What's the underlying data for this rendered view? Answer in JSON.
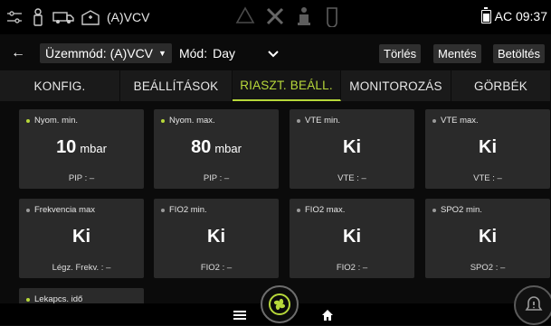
{
  "status": {
    "mode_text": "(A)VCV",
    "time_text": "AC 09:37"
  },
  "toolbar": {
    "mode_select": "Üzemmód: (A)VCV",
    "mod_label": "Mód:",
    "mod_value": "Day",
    "delete_label": "Törlés",
    "save_label": "Mentés",
    "load_label": "Betöltés"
  },
  "tabs": [
    {
      "label": "KONFIG."
    },
    {
      "label": "BEÁLLÍTÁSOK"
    },
    {
      "label": "RIASZT. BEÁLL."
    },
    {
      "label": "MONITOROZÁS"
    },
    {
      "label": "GÖRBÉK"
    }
  ],
  "active_tab_index": 2,
  "alarms": [
    {
      "title": "Nyom. min.",
      "value": "10",
      "unit": "mbar",
      "sub": "PIP : –"
    },
    {
      "title": "Nyom. max.",
      "value": "80",
      "unit": "mbar",
      "sub": "PIP : –"
    },
    {
      "title": "VTE min.",
      "value": "Ki",
      "unit": "",
      "sub": "VTE : –"
    },
    {
      "title": "VTE max.",
      "value": "Ki",
      "unit": "",
      "sub": "VTE : –"
    },
    {
      "title": "Frekvencia max",
      "value": "Ki",
      "unit": "",
      "sub": "Légz. Frekv. : –"
    },
    {
      "title": "FIO2 min.",
      "value": "Ki",
      "unit": "",
      "sub": "FIO2 : –"
    },
    {
      "title": "FIO2 max.",
      "value": "Ki",
      "unit": "",
      "sub": "FIO2 : –"
    },
    {
      "title": "SPO2 min.",
      "value": "Ki",
      "unit": "",
      "sub": "SPO2 : –"
    },
    {
      "title": "Lekapcs. idő",
      "value": "",
      "unit": "",
      "sub": ""
    }
  ],
  "colors": {
    "accent": "#b7d83a",
    "card_bg": "#2a2a2a",
    "background": "#0b0b0b"
  },
  "icons": [
    "settings-sliders-icon",
    "person-icon",
    "ambulance-icon",
    "hospital-icon",
    "warning-triangle-icon",
    "tools-icon",
    "patient-icon",
    "oxygen-icon",
    "battery-icon",
    "back-arrow-icon",
    "menu-icon",
    "fan-icon",
    "home-icon",
    "alarm-bell-icon"
  ]
}
